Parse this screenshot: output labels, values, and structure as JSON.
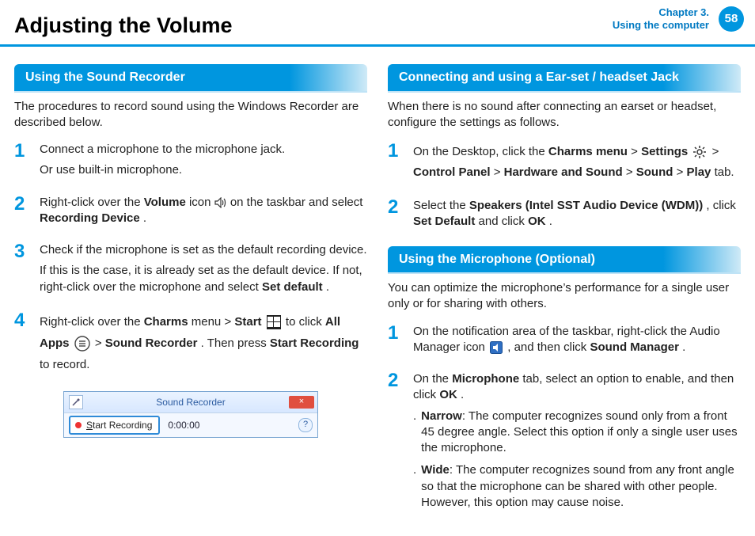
{
  "header": {
    "title": "Adjusting the Volume",
    "chapter_line1": "Chapter 3.",
    "chapter_line2": "Using the computer",
    "page_number": "58"
  },
  "left": {
    "section_title": "Using the Sound Recorder",
    "intro": "The procedures to record sound using the Windows Recorder are described below.",
    "steps": {
      "s1": {
        "num": "1",
        "p1": "Connect a microphone to the microphone jack.",
        "p2": "Or use built-in microphone."
      },
      "s2": {
        "num": "2",
        "pre": "Right-click over the ",
        "bold1": "Volume",
        "mid": " icon ",
        "post1": " on the taskbar and select ",
        "bold2": "Recording Device",
        "end": "."
      },
      "s3": {
        "num": "3",
        "p1": "Check if the microphone is set as the default recording device.",
        "p2a": "If this is the case, it is already set as the default device. If not, right-click over the microphone and select ",
        "p2b": "Set default",
        "p2c": "."
      },
      "s4": {
        "num": "4",
        "a": "Right-click over the ",
        "b": "Charms",
        "c": " menu > ",
        "d": "Start",
        "e": " to click ",
        "f": "All Apps",
        "g": " > ",
        "h": "Sound Recorder",
        "i": ". Then press ",
        "j": "Start Recording",
        "k": " to record."
      }
    },
    "recorder": {
      "title": "Sound Recorder",
      "button": "Start Recording",
      "time": "0:00:00",
      "close": "×",
      "help": "?"
    }
  },
  "right": {
    "sectA_title": "Connecting and using a Ear-set / headset Jack",
    "sectA_intro": "When there is no sound after connecting an earset or headset, configure the settings as follows.",
    "A1": {
      "num": "1",
      "a": "On the Desktop, click the ",
      "b": "Charms menu",
      "gt1": " > ",
      "c": "Settings",
      "gt2": " > ",
      "d": "Control Panel",
      "gt3": " > ",
      "e": "Hardware and Sound",
      "gt4": " > ",
      "f": "Sound",
      "gt5": " > ",
      "g": "Play",
      "h": " tab."
    },
    "A2": {
      "num": "2",
      "a": "Select the ",
      "b": "Speakers (Intel SST Audio Device (WDM))",
      "c": ", click ",
      "d": "Set Default",
      "e": " and click ",
      "f": "OK",
      "g": "."
    },
    "sectB_title": "Using the Microphone (Optional)",
    "sectB_intro": "You can optimize the microphone’s performance for a single user only or for sharing with others.",
    "B1": {
      "num": "1",
      "a": "On the notification area of the taskbar, right-click the Audio Manager icon ",
      "b": " , and then click ",
      "c": "Sound Manager",
      "d": "."
    },
    "B2": {
      "num": "2",
      "a": "On the ",
      "b": "Microphone",
      "c": " tab, select an option to enable, and then click ",
      "d": "OK",
      "e": "."
    },
    "narrow": {
      "dot": ".",
      "label": "Narrow",
      "text": ": The computer recognizes sound only from a front 45 degree angle. Select this option if only a single user uses the microphone."
    },
    "wide": {
      "dot": ".",
      "label": "Wide",
      "text": ": The computer recognizes sound from any front angle so that the microphone can be shared with other people. However, this option may cause noise."
    }
  }
}
